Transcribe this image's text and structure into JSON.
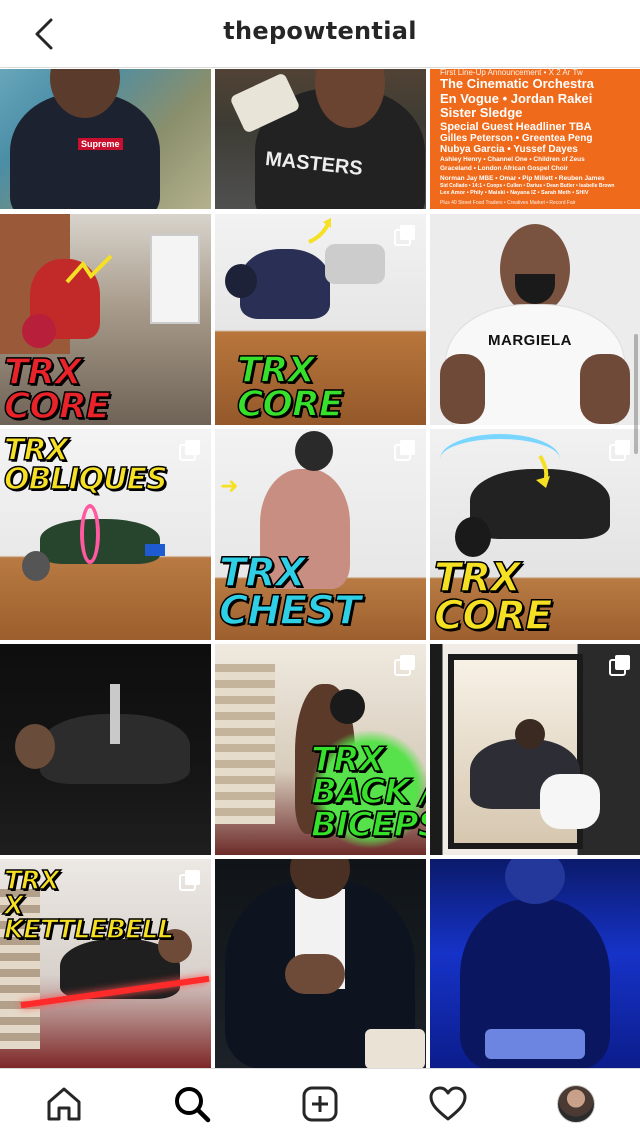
{
  "header": {
    "title": "thepowtential",
    "back_icon": "chevron-left-icon"
  },
  "grid": {
    "rows": [
      [
        {
          "type": "photo",
          "text": "Supreme",
          "multiple": false
        },
        {
          "type": "photo",
          "text": "MASTERS",
          "multiple": false
        },
        {
          "type": "poster",
          "multiple": false
        }
      ],
      [
        {
          "type": "photo",
          "overlay": [
            "TRX",
            "CORE"
          ],
          "multiple": false
        },
        {
          "type": "photo",
          "overlay": [
            "TRX",
            "CORE"
          ],
          "multiple": true
        },
        {
          "type": "photo",
          "text": "MARGIELA",
          "multiple": false
        }
      ],
      [
        {
          "type": "photo",
          "overlay": [
            "TRX",
            "OBLIQUES"
          ],
          "multiple": true
        },
        {
          "type": "photo",
          "overlay": [
            "TRX",
            "CHEST"
          ],
          "multiple": true
        },
        {
          "type": "photo",
          "overlay": [
            "TRX",
            "CORE"
          ],
          "multiple": true
        }
      ],
      [
        {
          "type": "photo",
          "multiple": false
        },
        {
          "type": "photo",
          "overlay": [
            "TRX",
            "BACK /",
            "BICEPS"
          ],
          "multiple": true
        },
        {
          "type": "photo",
          "multiple": true
        }
      ],
      [
        {
          "type": "photo",
          "overlay": [
            "TRX",
            "X",
            "KETTLEBELL"
          ],
          "multiple": true
        },
        {
          "type": "photo",
          "multiple": false
        },
        {
          "type": "photo",
          "multiple": false
        }
      ]
    ]
  },
  "poster": {
    "top": "First Line-Up Announcement • X 2 Ar Tw",
    "lines": [
      "The Cinematic Orchestra",
      "En Vogue • Jordan Rakei",
      "Sister Sledge",
      "Special Guest Headliner TBA",
      "Gilles Peterson • Greentea Peng",
      "Nubya Garcia • Yussef Dayes"
    ],
    "small": [
      "Ashley Henry • Channel One • Children of Zeus",
      "Graceland • London African Gospel Choir",
      "Norman Jay MBE • Omar • Pip Millett • Reuben James",
      "Sid Collado • 14:1 • Coops • Cullen • Darius • Dean Butler • Isabelle Brown",
      "Lex Amor • Phily • Maiski • Nayana IZ • Sarah Meth • SHIV"
    ],
    "foot": "Plus 40 Street Food Traders • Creatives Market • Record Fair"
  },
  "labels": {
    "supreme": "Supreme",
    "masters": "MASTERS",
    "margiela": "MARGIELA"
  },
  "tabbar": {
    "items": [
      "home-icon",
      "search-icon",
      "new-post-icon",
      "activity-heart-icon",
      "profile-avatar"
    ]
  },
  "colors": {
    "trx_red": "#e8232a",
    "trx_green": "#37e02a",
    "trx_yellow": "#f5e023",
    "trx_cyan": "#2fd0e6"
  }
}
